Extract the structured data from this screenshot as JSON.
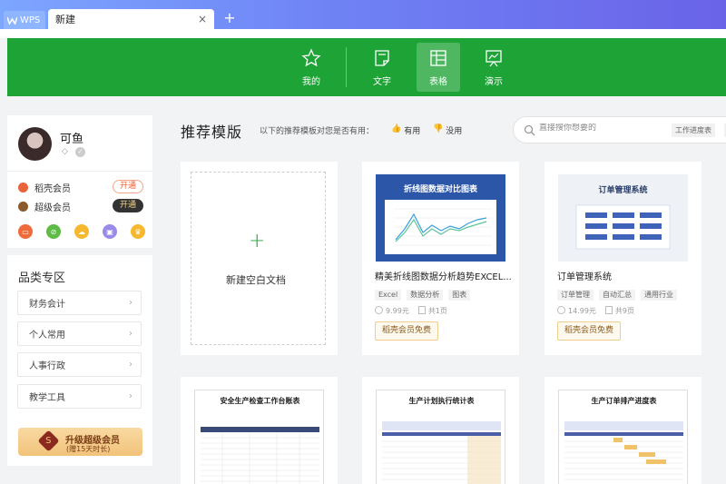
{
  "tabs": {
    "wps_label": "WPS",
    "doc_label": "新建",
    "close_glyph": "×",
    "new_tab_glyph": "+"
  },
  "nav": [
    {
      "label": "我的",
      "icon": "star-icon",
      "active": false
    },
    {
      "label": "文字",
      "icon": "document-icon",
      "active": false
    },
    {
      "label": "表格",
      "icon": "table-icon",
      "active": true
    },
    {
      "label": "演示",
      "icon": "presentation-icon",
      "active": false
    }
  ],
  "profile": {
    "name": "可鱼",
    "vip1": {
      "label": "稻壳会员",
      "button": "开通"
    },
    "vip2": {
      "label": "超级会员",
      "button": "开通"
    }
  },
  "categories": {
    "title": "品类专区",
    "items": [
      "财务会计",
      "个人常用",
      "人事行政",
      "教学工具"
    ]
  },
  "upgrade": {
    "line1": "升级超级会员",
    "line2": "(赠15天时长)"
  },
  "main": {
    "title": "推荐模版",
    "question": "以下的推荐模板对您是否有用：",
    "useful": "有用",
    "useless": "没用",
    "search_placeholder": "直接搜你想要的",
    "search_tag": "工作进度表"
  },
  "new_doc_label": "新建空白文档",
  "templates": [
    {
      "name": "精美折线图数据分析趋势EXCEL...",
      "thumb_title": "折线图数据对比图表",
      "tags": [
        "Excel",
        "数据分析",
        "图表"
      ],
      "price": "9.99元",
      "pages": "共1页",
      "badge": "稻壳会员免费"
    },
    {
      "name": "订单管理系统",
      "thumb_title": "订单管理系统",
      "tags": [
        "订单管理",
        "自动汇总",
        "通用行业"
      ],
      "price": "14.99元",
      "pages": "共9页",
      "badge": "稻壳会员免费"
    }
  ],
  "row2": [
    {
      "thumb_title": "安全生产检查工作台账表"
    },
    {
      "thumb_title": "生产计划执行统计表"
    },
    {
      "thumb_title": "生产订单排产进度表"
    }
  ],
  "colors": {
    "green": "#1ea337",
    "tab_gradient_start": "#7da6ff",
    "tab_gradient_end": "#6a63e8"
  }
}
